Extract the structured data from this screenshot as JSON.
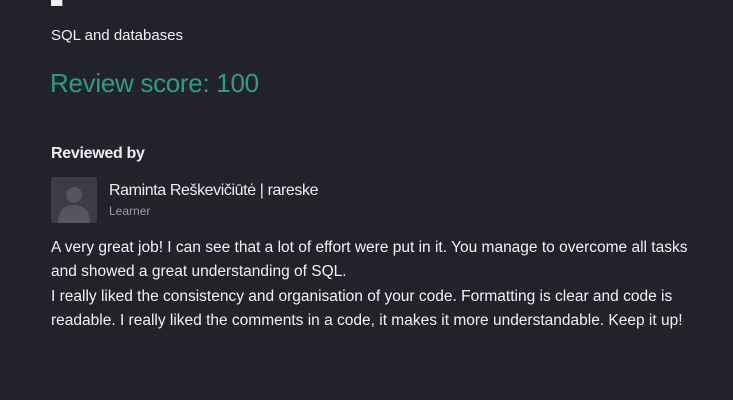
{
  "header": {
    "topic": "SQL and databases",
    "score_text": "Review score: 100"
  },
  "review": {
    "heading": "Reviewed by",
    "reviewer": {
      "name": "Raminta Reškevičiūtė | rareske",
      "role": "Learner",
      "avatar_icon": "user-avatar-icon"
    },
    "comment_paragraphs": [
      "A very great job! I can see that a lot of effort were put in it. You manage to overcome all tasks and showed a great understanding of SQL.",
      "I really liked the consistency and organisation of your code. Formatting is clear and code is readable. I really liked the comments in a code, it makes it more understandable. Keep it up!"
    ]
  },
  "colors": {
    "background": "#22232a",
    "score_accent": "#2f9a8a",
    "muted_text": "#9a9ba3"
  }
}
